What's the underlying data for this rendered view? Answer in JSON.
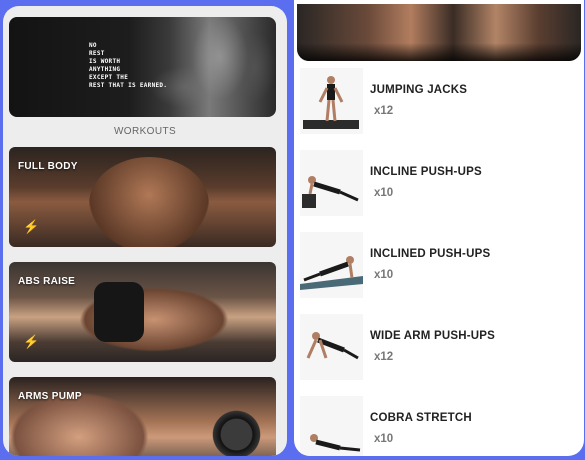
{
  "left_screen": {
    "hero_quote": [
      "NO",
      "REST",
      "IS WORTH",
      "ANYTHING",
      "EXCEPT THE",
      "REST THAT IS EARNED."
    ],
    "section_title": "WORKOUTS",
    "workouts": [
      {
        "label": "FULL BODY",
        "icon": "bolt-icon"
      },
      {
        "label": "ABS RAISE",
        "icon": "bolt-icon"
      },
      {
        "label": "ARMS PUMP",
        "icon": ""
      }
    ]
  },
  "right_screen": {
    "exercises": [
      {
        "name": "JUMPING JACKS",
        "reps": "x12"
      },
      {
        "name": "INCLINE PUSH-UPS",
        "reps": "x10"
      },
      {
        "name": "INCLINED PUSH-UPS",
        "reps": "x10"
      },
      {
        "name": "WIDE ARM PUSH-UPS",
        "reps": "x12"
      },
      {
        "name": "COBRA STRETCH",
        "reps": "x10"
      }
    ]
  },
  "colors": {
    "background": "#5b6ef0",
    "list_bg": "#ffffff",
    "card_text": "#ffffff",
    "reps_text": "#777777"
  }
}
